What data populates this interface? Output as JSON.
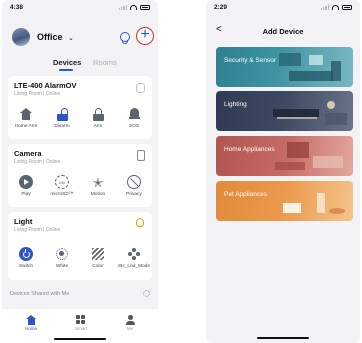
{
  "left": {
    "status_time": "4:38",
    "home_name": "Office",
    "tabs": [
      {
        "label": "Devices"
      },
      {
        "label": "Rooms"
      }
    ],
    "cards": [
      {
        "title": "LTE-400 AlarmOV",
        "subtitle": "Living Room | Online",
        "actions": [
          {
            "label": "Home Arm",
            "icon": "house-icon"
          },
          {
            "label": "Disarm",
            "icon": "unlocked-icon"
          },
          {
            "label": "Arm",
            "icon": "lock-icon"
          },
          {
            "label": "SOS",
            "icon": "bell-icon"
          }
        ]
      },
      {
        "title": "Camera",
        "subtitle": "Living Room | Online",
        "actions": [
          {
            "label": "Play",
            "icon": "play-icon"
          },
          {
            "label": "microSD™",
            "icon": "sd-24h-icon",
            "badge": "24h"
          },
          {
            "label": "Motion",
            "icon": "running-person-icon"
          },
          {
            "label": "Privacy",
            "icon": "camera-off-icon"
          }
        ]
      },
      {
        "title": "Light",
        "subtitle": "Living Room | Online",
        "actions": [
          {
            "label": "Switch",
            "icon": "power-icon"
          },
          {
            "label": "White",
            "icon": "sun-icon"
          },
          {
            "label": "Color",
            "icon": "stripes-icon"
          },
          {
            "label": "SH_Led_Mode",
            "icon": "dots-icon"
          }
        ]
      }
    ],
    "shared_label": "Devices Shared with Me",
    "nav": [
      {
        "label": "Home",
        "icon": "home-icon"
      },
      {
        "label": "Smart",
        "icon": "grid-icon"
      },
      {
        "label": "Me",
        "icon": "person-icon"
      }
    ],
    "accent": "#2d57c9",
    "highlight": "#e02929"
  },
  "right": {
    "status_time": "2:29",
    "title": "Add Device",
    "back_glyph": "<",
    "categories": [
      {
        "label": "Security & Sensor",
        "color": "#3f94a4"
      },
      {
        "label": "Lighting",
        "color": "#3d4a62"
      },
      {
        "label": "Home Appliances",
        "color": "#c56a64"
      },
      {
        "label": "Pet Appliances",
        "color": "#eb9a4d"
      }
    ]
  }
}
